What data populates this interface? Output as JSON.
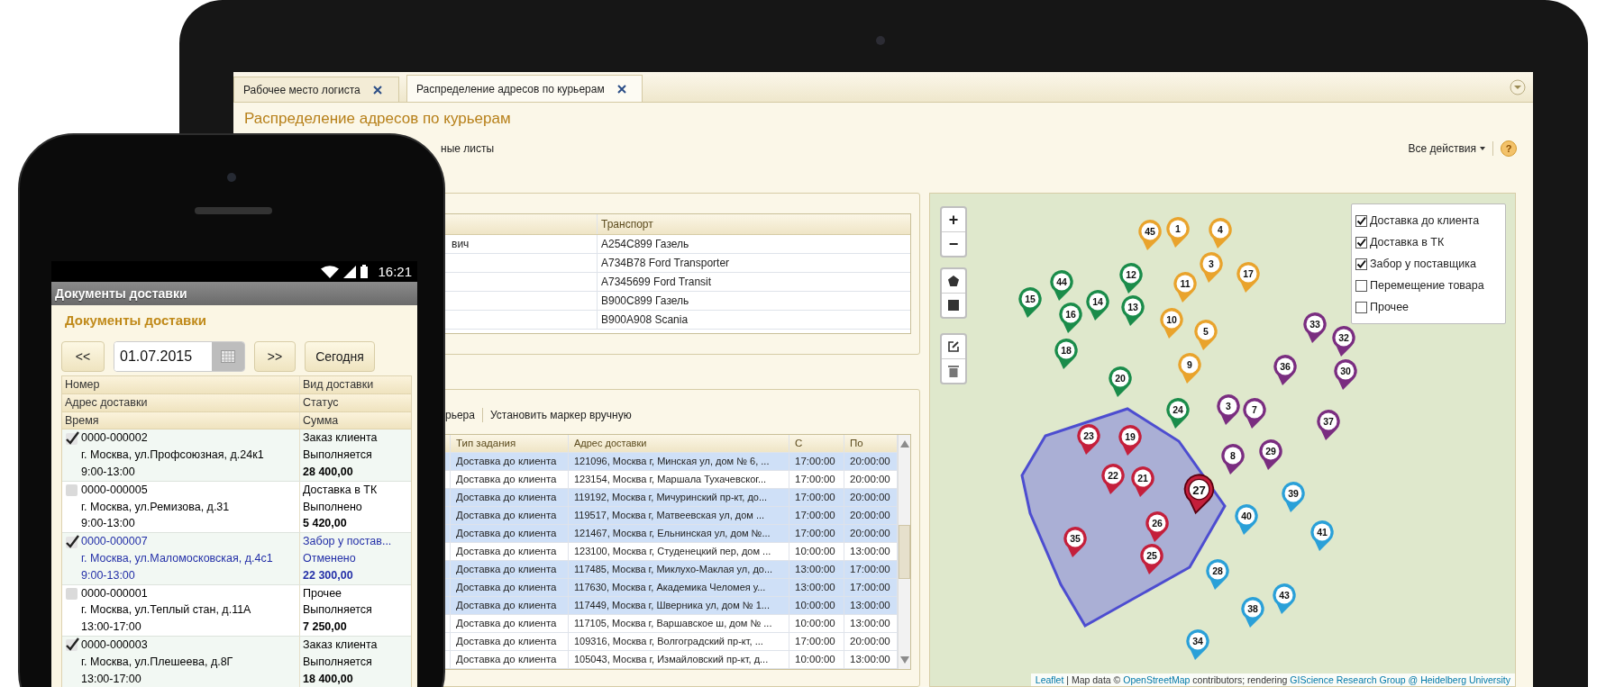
{
  "tablet": {
    "tabs": [
      {
        "label": "Рабочее место логиста",
        "selected": false
      },
      {
        "label": "Распределение адресов по курьерам",
        "selected": true
      }
    ],
    "title": "Распределение адресов по курьерам",
    "toolbar": {
      "fragment": "ные листы",
      "all_actions": "Все действия",
      "help": "?"
    },
    "couriers": {
      "header": "Транспорт",
      "rows": [
        {
          "column_1": "вич",
          "transport": "А254С899 Газель"
        },
        {
          "transport": "А734В78 Ford Transporter"
        },
        {
          "transport": "А7345699 Ford Transit"
        },
        {
          "transport": "В900С899 Газель"
        },
        {
          "transport": "В900А908  Scania"
        }
      ]
    },
    "tasks": {
      "toolbar": {
        "fragment": "рьера",
        "set_marker": "Установить маркер вручную"
      },
      "columns": [
        "Тип задания",
        "Адрес доставки",
        "С",
        "По"
      ],
      "rows": [
        {
          "type": "Доставка до клиента",
          "address": "121096, Москва г, Минская ул, дом № 6, ...",
          "from": "17:00:00",
          "to": "20:00:00",
          "selected": true
        },
        {
          "type": "Доставка до клиента",
          "address": "123154, Москва г, Маршала Тухачевског...",
          "from": "17:00:00",
          "to": "20:00:00",
          "selected": false
        },
        {
          "type": "Доставка до клиента",
          "address": "119192, Москва г, Мичуринский пр-кт, до...",
          "from": "17:00:00",
          "to": "20:00:00",
          "selected": true
        },
        {
          "type": "Доставка до клиента",
          "address": "119517, Москва г, Матвеевская ул, дом ...",
          "from": "17:00:00",
          "to": "20:00:00",
          "selected": true
        },
        {
          "type": "Доставка до клиента",
          "address": "121467, Москва г, Ельнинская ул, дом №...",
          "from": "17:00:00",
          "to": "20:00:00",
          "selected": true
        },
        {
          "type": "Доставка до клиента",
          "address": "123100, Москва г, Студенецкий пер, дом ...",
          "from": "10:00:00",
          "to": "13:00:00",
          "selected": false
        },
        {
          "type": "Доставка до клиента",
          "address": "117485, Москва г, Миклухо-Маклая ул, до...",
          "from": "13:00:00",
          "to": "17:00:00",
          "selected": true
        },
        {
          "type": "Доставка до клиента",
          "address": "117630, Москва г, Академика Челомея у...",
          "from": "13:00:00",
          "to": "17:00:00",
          "selected": true
        },
        {
          "type": "Доставка до клиента",
          "address": "117449, Москва г, Шверника ул, дом № 1...",
          "from": "10:00:00",
          "to": "13:00:00",
          "selected": true
        },
        {
          "type": "Доставка до клиента",
          "address": "117105, Москва г, Варшавское ш, дом № ...",
          "from": "10:00:00",
          "to": "13:00:00",
          "selected": false
        },
        {
          "type": "Доставка до клиента",
          "address": "109316, Москва г, Волгоградский пр-кт, ...",
          "from": "17:00:00",
          "to": "20:00:00",
          "selected": false
        },
        {
          "type": "Доставка до клиента",
          "address": "105043, Москва г, Измайловский пр-кт, д...",
          "from": "10:00:00",
          "to": "13:00:00",
          "selected": false
        }
      ]
    },
    "map": {
      "zoom_in": "+",
      "zoom_out": "−",
      "layers": [
        {
          "label": "Доставка до клиента",
          "checked": true
        },
        {
          "label": "Доставка в ТК",
          "checked": true
        },
        {
          "label": "Забор у поставщика",
          "checked": true
        },
        {
          "label": "Перемещение товара",
          "checked": false
        },
        {
          "label": "Прочее",
          "checked": false
        }
      ],
      "markers": [
        {
          "label": "45",
          "color": "#e9a32c",
          "selected": false
        },
        {
          "label": "1",
          "color": "#e9a32c",
          "selected": false
        },
        {
          "label": "4",
          "color": "#e9a32c",
          "selected": false
        },
        {
          "label": "3",
          "color": "#e9a32c",
          "selected": false
        },
        {
          "label": "17",
          "color": "#e9a32c",
          "selected": false
        },
        {
          "label": "12",
          "color": "#1a8c4a",
          "selected": false
        },
        {
          "label": "11",
          "color": "#e9a32c",
          "selected": false
        },
        {
          "label": "44",
          "color": "#1a8c4a",
          "selected": false
        },
        {
          "label": "15",
          "color": "#1a8c4a",
          "selected": false
        },
        {
          "label": "16",
          "color": "#1a8c4a",
          "selected": false
        },
        {
          "label": "14",
          "color": "#1a8c4a",
          "selected": false
        },
        {
          "label": "13",
          "color": "#1a8c4a",
          "selected": false
        },
        {
          "label": "10",
          "color": "#e9a32c",
          "selected": false
        },
        {
          "label": "5",
          "color": "#e9a32c",
          "selected": false
        },
        {
          "label": "33",
          "color": "#7a2d80",
          "selected": false
        },
        {
          "label": "32",
          "color": "#7a2d80",
          "selected": false
        },
        {
          "label": "9",
          "color": "#e9a32c",
          "selected": false
        },
        {
          "label": "18",
          "color": "#1a8c4a",
          "selected": false
        },
        {
          "label": "36",
          "color": "#7a2d80",
          "selected": false
        },
        {
          "label": "30",
          "color": "#7a2d80",
          "selected": false
        },
        {
          "label": "20",
          "color": "#1a8c4a",
          "selected": false
        },
        {
          "label": "24",
          "color": "#1a8c4a",
          "selected": false
        },
        {
          "label": "3",
          "color": "#7a2d80",
          "selected": false
        },
        {
          "label": "7",
          "color": "#7a2d80",
          "selected": false
        },
        {
          "label": "37",
          "color": "#7a2d80",
          "selected": false
        },
        {
          "label": "23",
          "color": "#c41f3b",
          "selected": false
        },
        {
          "label": "19",
          "color": "#c41f3b",
          "selected": false
        },
        {
          "label": "8",
          "color": "#7a2d80",
          "selected": false
        },
        {
          "label": "29",
          "color": "#7a2d80",
          "selected": false
        },
        {
          "label": "22",
          "color": "#c41f3b",
          "selected": false
        },
        {
          "label": "21",
          "color": "#c41f3b",
          "selected": false
        },
        {
          "label": "27",
          "color": "#c41f3b",
          "selected": true
        },
        {
          "label": "39",
          "color": "#2aa0d8",
          "selected": false
        },
        {
          "label": "40",
          "color": "#2aa0d8",
          "selected": false
        },
        {
          "label": "35",
          "color": "#c41f3b",
          "selected": false
        },
        {
          "label": "26",
          "color": "#c41f3b",
          "selected": false
        },
        {
          "label": "41",
          "color": "#2aa0d8",
          "selected": false
        },
        {
          "label": "25",
          "color": "#c41f3b",
          "selected": false
        },
        {
          "label": "28",
          "color": "#2aa0d8",
          "selected": false
        },
        {
          "label": "43",
          "color": "#2aa0d8",
          "selected": false
        },
        {
          "label": "38",
          "color": "#2aa0d8",
          "selected": false
        },
        {
          "label": "34",
          "color": "#2aa0d8",
          "selected": false
        }
      ],
      "attribution": [
        {
          "text": "Leaflet",
          "link": true
        },
        {
          "text": " | Map data © ",
          "link": false
        },
        {
          "text": "OpenStreetMap",
          "link": true
        },
        {
          "text": " contributors; rendering ",
          "link": false
        },
        {
          "text": "GIScience Research Group @ Heidelberg University",
          "link": true
        }
      ]
    }
  },
  "phone": {
    "time": "16:21",
    "app_title": "Документы доставки",
    "title": "Документы доставки",
    "prev": "<<",
    "date": "01.07.2015",
    "next": ">>",
    "today": "Сегодня",
    "headers": [
      [
        "Номер",
        "Вид доставки"
      ],
      [
        "Адрес доставки",
        "Статус"
      ],
      [
        "Время",
        "Сумма"
      ]
    ],
    "records": [
      {
        "checked": true,
        "selected": false,
        "number": "0000-000002",
        "type": "Заказ клиента",
        "address": "г. Москва, ул.Профсоюзная, д.24к1",
        "status": "Выполняется",
        "time": "9:00-13:00",
        "sum": "28 400,00"
      },
      {
        "checked": false,
        "selected": false,
        "number": "0000-000005",
        "type": "Доставка в ТК",
        "address": "г. Москва, ул.Ремизова, д.31",
        "status": "Выполнено",
        "time": "9:00-13:00",
        "sum": "5 420,00"
      },
      {
        "checked": true,
        "selected": true,
        "number": "0000-000007",
        "type": "Забор у постав...",
        "address": "г. Москва, ул.Маломосковская, д.4с1",
        "status": "Отменено",
        "time": "9:00-13:00",
        "sum": "22 300,00"
      },
      {
        "checked": false,
        "selected": false,
        "number": "0000-000001",
        "type": "Прочее",
        "address": "г. Москва, ул.Теплый стан, д.11А",
        "status": "Выполняется",
        "time": "13:00-17:00",
        "sum": "7 250,00"
      },
      {
        "checked": true,
        "selected": false,
        "number": "0000-000003",
        "type": "Заказ клиента",
        "address": "г. Москва, ул.Плешеева, д.8Г",
        "status": "Выполняется",
        "time": "13:00-17:00",
        "sum": "18 400,00"
      }
    ]
  }
}
